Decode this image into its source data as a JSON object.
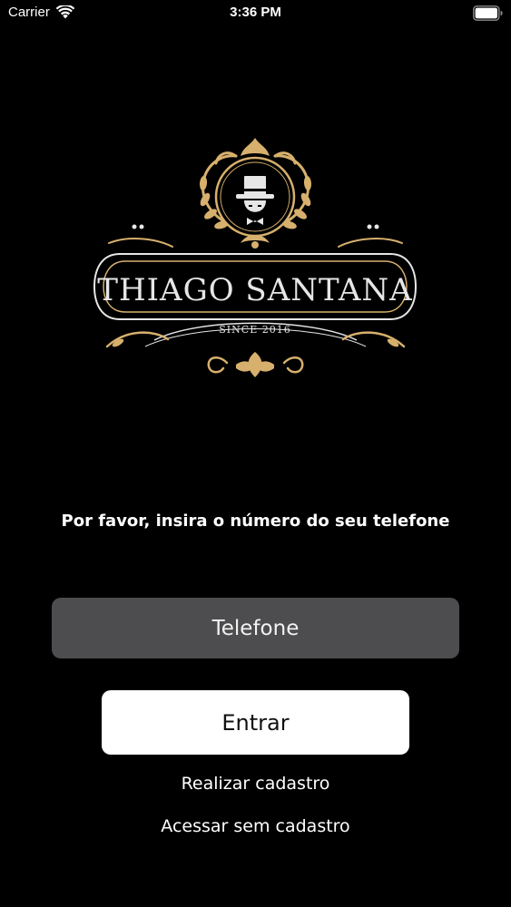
{
  "status_bar": {
    "carrier": "Carrier",
    "time": "3:36 PM",
    "icons": [
      "wifi-icon",
      "battery-icon"
    ]
  },
  "logo": {
    "title": "THIAGO SANTANA",
    "since": "SINCE 2016",
    "colors": {
      "gold": "#d7b06d",
      "cream": "#e6e6e6"
    }
  },
  "login": {
    "prompt": "Por favor, insira o número do seu telefone",
    "phone_placeholder": "Telefone",
    "phone_value": "",
    "enter_label": "Entrar",
    "register_link": "Realizar cadastro",
    "guest_link": "Acessar sem cadastro"
  },
  "colors": {
    "background": "#000000",
    "input_background": "#4d4c4e",
    "button_background": "#ffffff",
    "text": "#ffffff"
  }
}
